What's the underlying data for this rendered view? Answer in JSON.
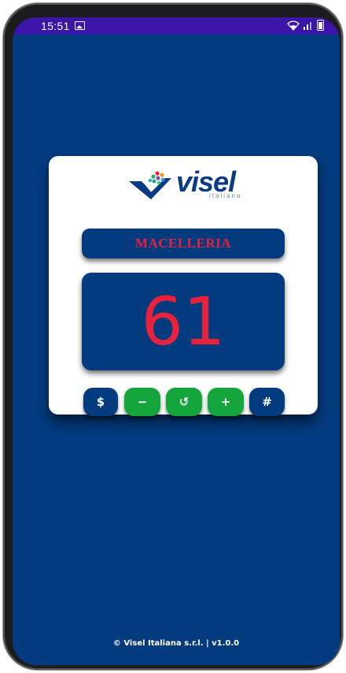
{
  "status_bar": {
    "time": "15:51",
    "bar_color": "#3b14a8"
  },
  "app": {
    "background_color": "#033b7e",
    "logo": {
      "word": "visel",
      "sub": "italiana"
    },
    "department": "MACELLERIA",
    "counter_value": "61",
    "accent_color": "#e8213c",
    "buttons": [
      {
        "label": "$",
        "icon": "dollar-icon",
        "color": "#033b7e"
      },
      {
        "label": "−",
        "icon": "minus-icon",
        "color": "#14a53d"
      },
      {
        "label": "↺",
        "icon": "reset-icon",
        "color": "#14a53d"
      },
      {
        "label": "+",
        "icon": "plus-icon",
        "color": "#14a53d"
      },
      {
        "label": "#",
        "icon": "hash-icon",
        "color": "#033b7e"
      }
    ],
    "footer": "© Visel Italiana s.r.l.  |  v1.0.0"
  }
}
